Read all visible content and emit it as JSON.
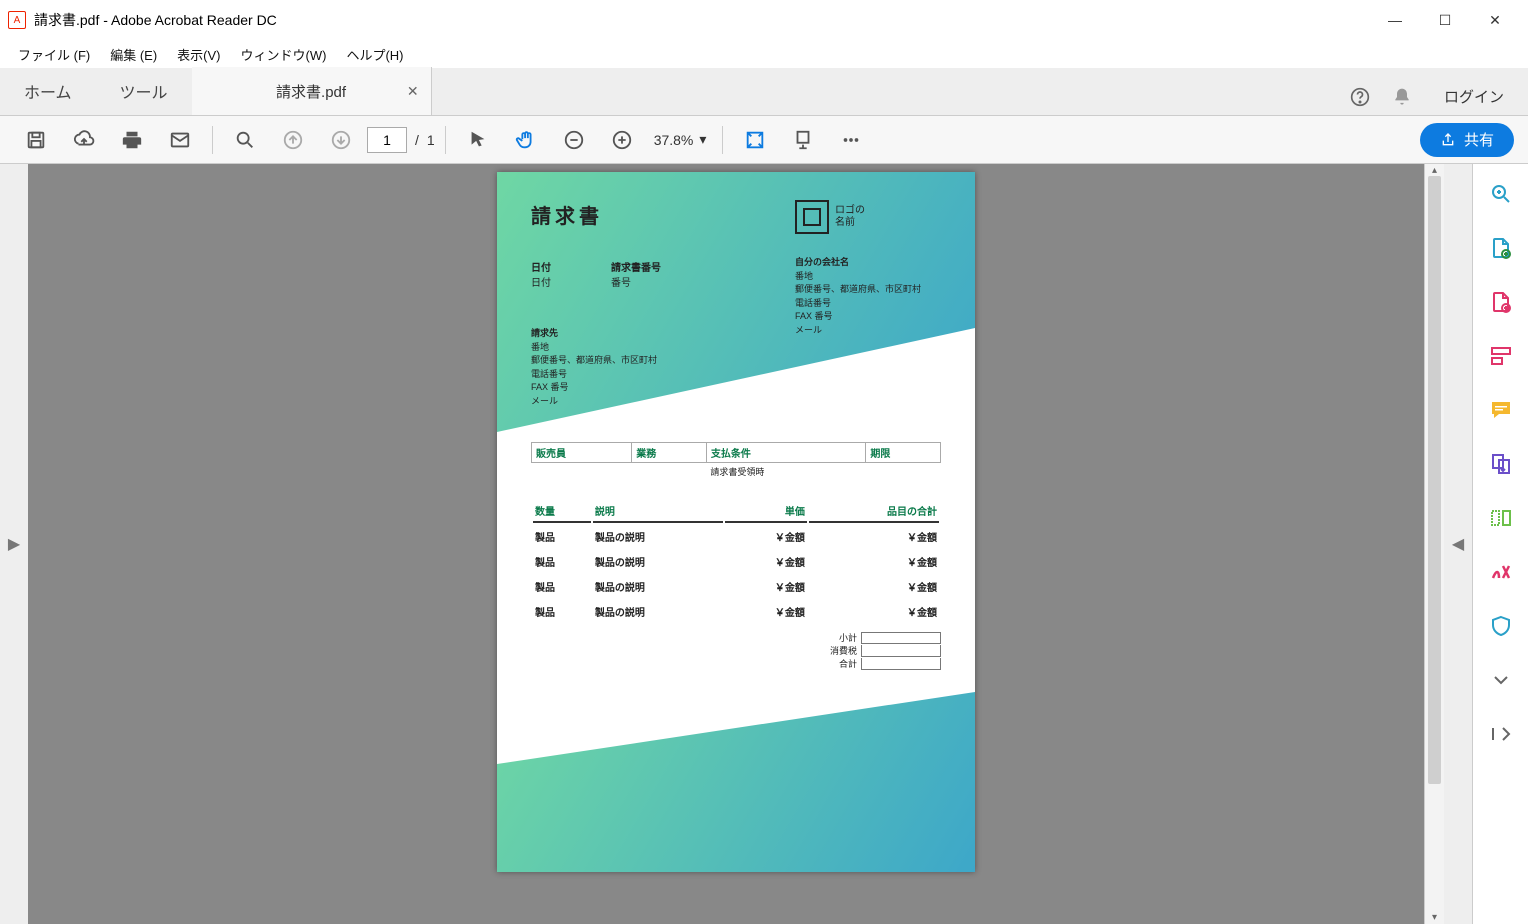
{
  "window": {
    "title": "請求書.pdf - Adobe Acrobat Reader DC"
  },
  "menubar": {
    "file": "ファイル (F)",
    "edit": "編集 (E)",
    "view": "表示(V)",
    "window": "ウィンドウ(W)",
    "help": "ヘルプ(H)"
  },
  "tabs": {
    "home": "ホーム",
    "tools": "ツール",
    "doc": "請求書.pdf",
    "login": "ログイン"
  },
  "toolbar": {
    "page_current": "1",
    "page_sep": "/",
    "page_total": "1",
    "zoom": "37.8%",
    "share": "共有"
  },
  "invoice": {
    "title": "請求書",
    "logo_text_1": "ロゴの",
    "logo_text_2": "名前",
    "date_label": "日付",
    "date_value": "日付",
    "number_label": "請求書番号",
    "number_value": "番号",
    "company_name": "自分の会社名",
    "company_lines": [
      "番地",
      "郵便番号、都道府県、市区町村",
      "電話番号",
      "FAX 番号",
      "メール"
    ],
    "bill_to_label": "請求先",
    "bill_to_lines": [
      "番地",
      "郵便番号、都道府県、市区町村",
      "電話番号",
      "FAX 番号",
      "メール"
    ],
    "t1_headers": [
      "販売員",
      "業務",
      "支払条件",
      "期限"
    ],
    "t1_payment": "請求書受領時",
    "t2_headers": [
      "数量",
      "説明",
      "単価",
      "品目の合計"
    ],
    "rows": [
      {
        "qty": "製品",
        "desc": "製品の説明",
        "unit": "￥金額",
        "total": "￥金額"
      },
      {
        "qty": "製品",
        "desc": "製品の説明",
        "unit": "￥金額",
        "total": "￥金額"
      },
      {
        "qty": "製品",
        "desc": "製品の説明",
        "unit": "￥金額",
        "total": "￥金額"
      },
      {
        "qty": "製品",
        "desc": "製品の説明",
        "unit": "￥金額",
        "total": "￥金額"
      }
    ],
    "totals": {
      "subtotal": "小計",
      "tax": "消費税",
      "total": "合計"
    }
  }
}
